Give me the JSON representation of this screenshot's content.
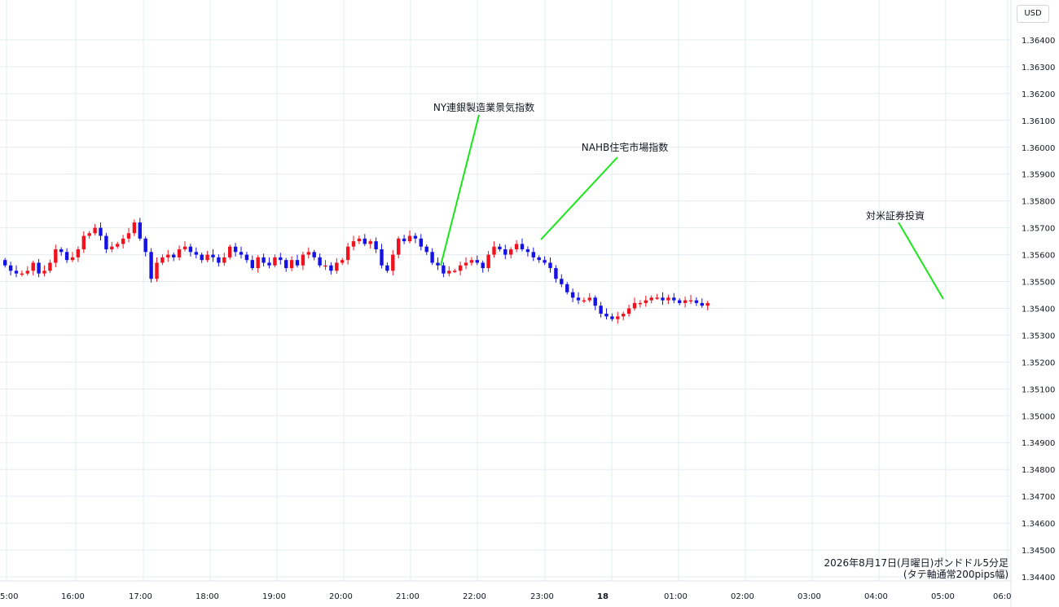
{
  "currency_label": "USD",
  "caption": {
    "line1": "2026年8月17日(月曜日)ポンドドル5分足",
    "line2": "(タテ軸通常200pips幅)"
  },
  "colors": {
    "up": "#f0121e",
    "down": "#1512e6",
    "annotation_line": "#19e619",
    "grid": "#e3ecf3"
  },
  "chart_data": {
    "type": "candlestick",
    "interval_minutes": 5,
    "y_range": [
      1.344,
      1.365
    ],
    "y_ticks": [
      "1.34400",
      "1.34500",
      "1.34600",
      "1.34700",
      "1.34800",
      "1.34900",
      "1.35000",
      "1.35100",
      "1.35200",
      "1.35300",
      "1.35400",
      "1.35500",
      "1.35600",
      "1.35700",
      "1.35800",
      "1.35900",
      "1.36000",
      "1.36100",
      "1.36200",
      "1.36300",
      "1.36400"
    ],
    "x_ticks": [
      "5:00",
      "16:00",
      "17:00",
      "18:00",
      "19:00",
      "20:00",
      "21:00",
      "22:00",
      "23:00",
      "18",
      "01:00",
      "02:00",
      "03:00",
      "04:00",
      "05:00",
      "06:0"
    ],
    "x_tick_bold": [
      false,
      false,
      false,
      false,
      false,
      false,
      false,
      false,
      false,
      true,
      false,
      false,
      false,
      false,
      false,
      false
    ],
    "close_series": [
      1.3556,
      1.3554,
      1.3553,
      1.3553,
      1.3554,
      1.3557,
      1.3553,
      1.3554,
      1.3557,
      1.3562,
      1.3561,
      1.3558,
      1.3559,
      1.3562,
      1.3567,
      1.3568,
      1.357,
      1.3567,
      1.3562,
      1.3563,
      1.3564,
      1.3566,
      1.3568,
      1.3572,
      1.3566,
      1.3561,
      1.3551,
      1.3557,
      1.3559,
      1.356,
      1.3559,
      1.3562,
      1.3563,
      1.3561,
      1.356,
      1.3558,
      1.356,
      1.3559,
      1.3557,
      1.3559,
      1.3563,
      1.3561,
      1.356,
      1.3558,
      1.3555,
      1.3559,
      1.3557,
      1.3556,
      1.3559,
      1.3558,
      1.3555,
      1.3558,
      1.3556,
      1.356,
      1.3561,
      1.3559,
      1.3556,
      1.3556,
      1.3554,
      1.3557,
      1.3558,
      1.3563,
      1.3565,
      1.3566,
      1.3564,
      1.3565,
      1.3562,
      1.3556,
      1.3554,
      1.356,
      1.3566,
      1.3565,
      1.3567,
      1.3566,
      1.3563,
      1.3561,
      1.3557,
      1.3556,
      1.3553,
      1.3554,
      1.3554,
      1.3556,
      1.3557,
      1.3558,
      1.3557,
      1.3555,
      1.356,
      1.3563,
      1.3562,
      1.356,
      1.3562,
      1.3564,
      1.3562,
      1.3561,
      1.3559,
      1.3558,
      1.3557,
      1.3555,
      1.3551,
      1.3549,
      1.3546,
      1.3544,
      1.3543,
      1.3543,
      1.3544,
      1.3541,
      1.3538,
      1.3537,
      1.3536,
      1.3537,
      1.3538,
      1.354,
      1.3542,
      1.3542,
      1.3543,
      1.3544,
      1.3544,
      1.3543,
      1.3544,
      1.3543,
      1.3542,
      1.3543,
      1.3543,
      1.3542,
      1.3541,
      1.3542
    ]
  },
  "annotations": [
    {
      "text": "NY連銀製造業景気指数"
    },
    {
      "text": "NAHB住宅市場指数"
    },
    {
      "text": "対米証券投資"
    }
  ]
}
